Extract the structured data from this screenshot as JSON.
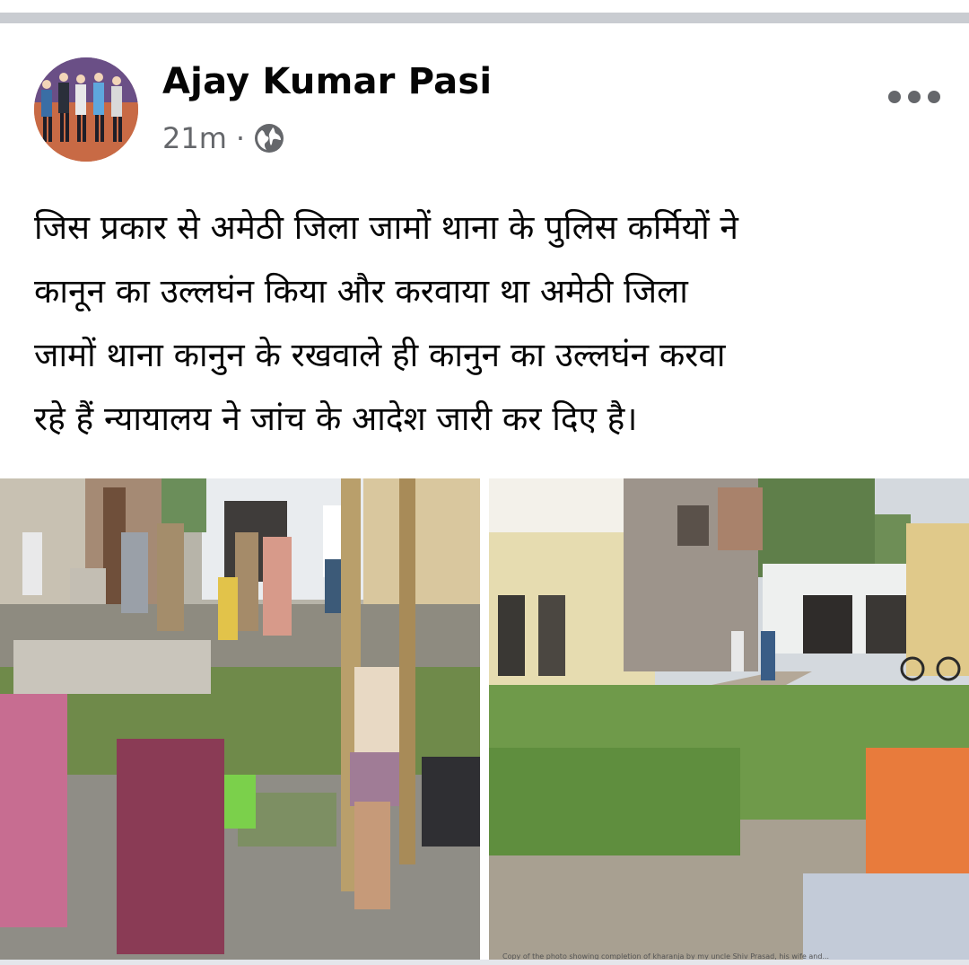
{
  "post": {
    "author": "Ajay Kumar Pasi",
    "timestamp": "21m",
    "separator": "·",
    "privacy_icon": "globe-icon",
    "more_icon": "more-horizontal-icon",
    "text_lines": [
      "जिस प्रकार से अमेठी जिला जामों थाना के पुलिस कर्मियों ने",
      "कानून का उल्लघंन किया और करवाया था अमेठी जिला",
      "जामों थाना कानुन के रखवाले ही कानुन का उल्लघंन करवा",
      "रहे हैं न्यायालय ने जांच के आदेश जारी कर दिए है।"
    ]
  },
  "photos": {
    "caption": "Copy of the photo showing completion of kharanja by my uncle Shiv Prasad, his wife and..."
  },
  "colors": {
    "text": "#050505",
    "secondary": "#65676b",
    "divider": "#c9ccd1"
  }
}
